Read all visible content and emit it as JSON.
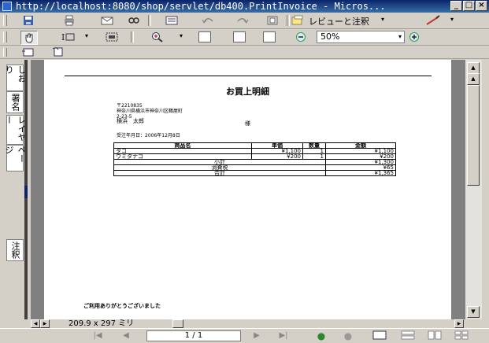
{
  "window": {
    "title": "http://localhost:8080/shop/servlet/db400.PrintInvoice - Micros...",
    "controls": {
      "minimize": "_",
      "maximize": "□",
      "close": "×"
    }
  },
  "toolbar1": {
    "icons": [
      "save-icon",
      "print-icon",
      "email-icon",
      "search-icon",
      "comment-icon",
      "undo-icon",
      "redo-icon",
      "page-icon"
    ],
    "review_label": "レビューと注釈",
    "review_dropdown": "▾"
  },
  "toolbar2": {
    "icons": [
      "hand-tool-icon",
      "select-text-icon",
      "snapshot-icon",
      "zoom-in-icon",
      "actual-size-icon",
      "fit-page-icon",
      "fit-width-icon",
      "zoom-out-icon",
      "zoom-plus-icon"
    ],
    "zoom_value": "50%"
  },
  "left_tabs": [
    "しおり",
    "署名",
    "レイヤー",
    "ページ",
    "注釈"
  ],
  "document": {
    "title": "お買上明細",
    "postal": "〒2210835",
    "address_line1": "神奈川県横浜市神奈川区鶴屋町",
    "address_line2": "2-23-5",
    "customer_name": "横浜　太郎",
    "honorific": "様",
    "order_date": "受注年月日：2006年12月8日",
    "table": {
      "headers": [
        "商品名",
        "単価",
        "数量",
        "金額"
      ],
      "rows": [
        {
          "name": "タコ",
          "price": "¥1,100",
          "qty": "1",
          "amount": "¥1,100"
        },
        {
          "name": "ウミタナゴ",
          "price": "¥200",
          "qty": "1",
          "amount": "¥200"
        }
      ],
      "subtotal_label": "小計",
      "subtotal": "¥1,300",
      "tax_label": "消費税",
      "tax": "¥65",
      "total_label": "合計",
      "total": "¥1,365"
    },
    "thanks": "ご利用ありがとうございました"
  },
  "page_size": "209.9 x 297 ミリ",
  "status": {
    "page_indicator": "1 / 1"
  }
}
